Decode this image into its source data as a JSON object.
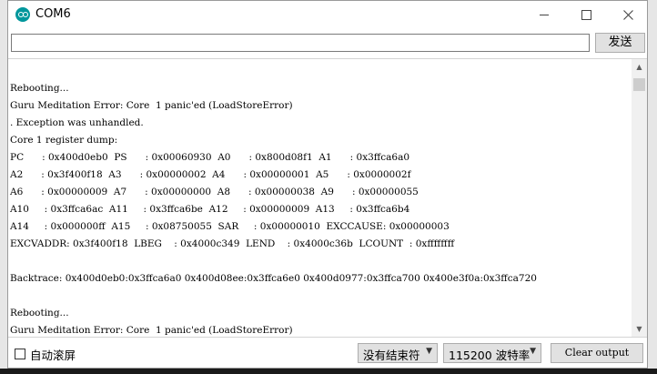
{
  "window": {
    "title": "COM6"
  },
  "send": {
    "input_value": "",
    "button_label": "发送"
  },
  "output": {
    "lines": [
      "Rebooting...",
      "Guru Meditation Error: Core  1 panic'ed (LoadStoreError)",
      ". Exception was unhandled.",
      "Core 1 register dump:",
      "PC      : 0x400d0eb0  PS      : 0x00060930  A0      : 0x800d08f1  A1      : 0x3ffca6a0",
      "A2      : 0x3f400f18  A3      : 0x00000002  A4      : 0x00000001  A5      : 0x0000002f",
      "A6      : 0x00000009  A7      : 0x00000000  A8      : 0x00000038  A9      : 0x00000055",
      "A10     : 0x3ffca6ac  A11     : 0x3ffca6be  A12     : 0x00000009  A13     : 0x3ffca6b4",
      "A14     : 0x000000ff  A15     : 0x08750055  SAR     : 0x00000010  EXCCAUSE: 0x00000003",
      "EXCVADDR: 0x3f400f18  LBEG    : 0x4000c349  LEND    : 0x4000c36b  LCOUNT  : 0xffffffff",
      "",
      "Backtrace: 0x400d0eb0:0x3ffca6a0 0x400d08ee:0x3ffca6e0 0x400d0977:0x3ffca700 0x400e3f0a:0x3ffca720",
      "",
      "Rebooting...",
      "Guru Meditation Error: Core  1 panic'ed (LoadStoreError)"
    ]
  },
  "footer": {
    "autoscroll_label": "自动滚屏",
    "autoscroll_checked": false,
    "line_ending": "没有结束符",
    "baud_rate": "115200 波特率",
    "clear_label": "Clear output"
  },
  "colors": {
    "app_icon": "#00979c",
    "button_bg": "#e1e1e1"
  }
}
